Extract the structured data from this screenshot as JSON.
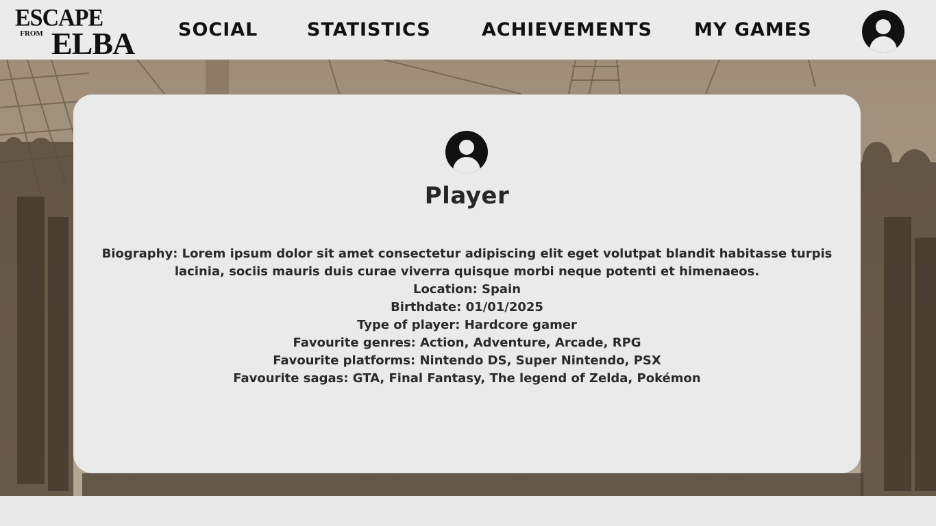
{
  "logo": {
    "line1": "ESCAPE",
    "line2": "FROM",
    "line3": "ELBA"
  },
  "nav": {
    "social": "SOCIAL",
    "statistics": "STATISTICS",
    "achievements": "ACHIEVEMENTS",
    "my_games": "MY GAMES",
    "account_icon": "user-circle-icon"
  },
  "profile": {
    "avatar_icon": "user-circle-icon",
    "name": "Player",
    "biography": "Biography: Lorem ipsum dolor sit amet consectetur adipiscing elit eget volutpat blandit habitasse turpis lacinia, sociis mauris duis curae viverra quisque morbi neque potenti et himenaeos.",
    "location": "Location: Spain",
    "birthdate": "Birthdate: 01/01/2025",
    "player_type": "Type of player: Hardcore gamer",
    "favourite_genres": "Favourite genres: Action, Adventure, Arcade, RPG",
    "favourite_platforms": "Favourite platforms: Nintendo DS, Super Nintendo, PSX",
    "favourite_sagas": "Favourite sagas: GTA, Final Fantasy, The legend of Zelda, Pokémon"
  },
  "colors": {
    "page_background": "#e9e9e9",
    "hero_sepia": "#a39480",
    "card_background": "#eaeaea",
    "text": "#262626",
    "icon": "#111111"
  }
}
